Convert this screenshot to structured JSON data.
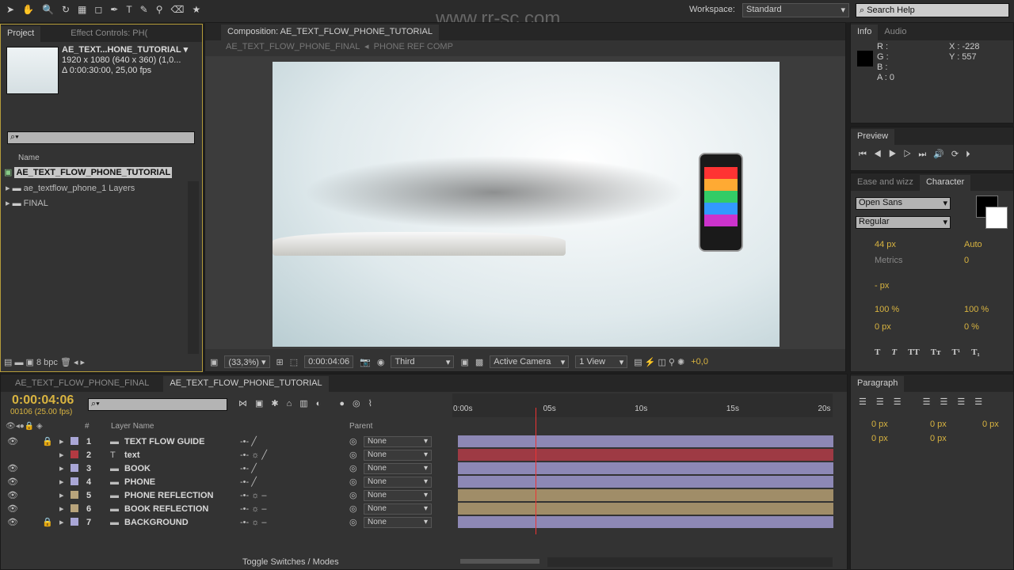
{
  "toolbar": {
    "workspace_label": "Workspace:",
    "workspace_value": "Standard",
    "search_placeholder": "Search Help",
    "watermark": "www.rr-sc.com"
  },
  "project": {
    "tab": "Project",
    "tab2": "Effect Controls: PH(",
    "comp_name": "AE_TEXT...HONE_TUTORIAL ▾",
    "comp_size": "1920 x 1080  (640 x 360) (1,0...",
    "comp_duration": "Δ 0:00:30:00, 25,00 fps",
    "column_name": "Name",
    "items": [
      {
        "label": "AE_TEXT_FLOW_PHONE_TUTORIAL",
        "type": "composition"
      },
      {
        "label": "ae_textflow_phone_1 Layers",
        "type": "folder"
      },
      {
        "label": "FINAL",
        "type": "folder"
      }
    ],
    "bpc": "8 bpc"
  },
  "composition": {
    "tab": "Composition: AE_TEXT_FLOW_PHONE_TUTORIAL",
    "breadcrumbs": [
      "AE_TEXT_FLOW_PHONE_FINAL",
      "PHONE REF COMP"
    ],
    "zoom": "(33,3%)",
    "timecode": "0:00:04:06",
    "resolution": "Third",
    "camera": "Active Camera",
    "views": "1 View",
    "exposure": "+0,0"
  },
  "info": {
    "tab": "Info",
    "tab2": "Audio",
    "r": "R :",
    "g": "G :",
    "b": "B :",
    "a": "A : 0",
    "x": "X : -228",
    "y": "Y : 557"
  },
  "preview": {
    "tab": "Preview"
  },
  "character": {
    "tab_other": "Ease and wizz",
    "tab": "Character",
    "font": "Open Sans",
    "style": "Regular",
    "size": "44 px",
    "leading": "Auto",
    "kerning": "Metrics",
    "tracking": "0",
    "stroke": "- px",
    "vscale": "100 %",
    "hscale": "100 %",
    "baseline": "0 px",
    "tsume": "0 %",
    "styles": [
      "T",
      "T",
      "TT",
      "Tт",
      "T¹",
      "T₁"
    ]
  },
  "paragraph": {
    "tab": "Paragraph",
    "indents": [
      "0 px",
      "0 px",
      "0 px",
      "0 px",
      "0 px"
    ]
  },
  "timeline": {
    "tabs": [
      "AE_TEXT_FLOW_PHONE_FINAL",
      "AE_TEXT_FLOW_PHONE_TUTORIAL"
    ],
    "timecode": "0:00:04:06",
    "frames": "00106 (25.00 fps)",
    "col_num": "#",
    "col_layer": "Layer Name",
    "col_parent": "Parent",
    "ruler": [
      "0:00s",
      "05s",
      "10s",
      "15s",
      "20s"
    ],
    "current_time_s": 4.24,
    "layers": [
      {
        "num": "1",
        "name": "TEXT FLOW GUIDE",
        "color": "#a9a6d6",
        "track": "#8d88b5",
        "parent": "None",
        "lock": true
      },
      {
        "num": "2",
        "name": "text",
        "color": "#b33a42",
        "track": "#9e3a44",
        "parent": "None",
        "lock": false
      },
      {
        "num": "3",
        "name": "BOOK",
        "color": "#a9a6d6",
        "track": "#8d88b5",
        "parent": "None",
        "lock": false
      },
      {
        "num": "4",
        "name": "PHONE",
        "color": "#a9a6d6",
        "track": "#8d88b5",
        "parent": "None",
        "lock": false
      },
      {
        "num": "5",
        "name": "PHONE REFLECTION",
        "color": "#b8a47c",
        "track": "#a08d68",
        "parent": "None",
        "lock": false
      },
      {
        "num": "6",
        "name": "BOOK REFLECTION",
        "color": "#b8a47c",
        "track": "#a08d68",
        "parent": "None",
        "lock": false
      },
      {
        "num": "7",
        "name": "BACKGROUND",
        "color": "#a9a6d6",
        "track": "#8d88b5",
        "parent": "None",
        "lock": true
      }
    ],
    "toggle": "Toggle Switches / Modes"
  }
}
